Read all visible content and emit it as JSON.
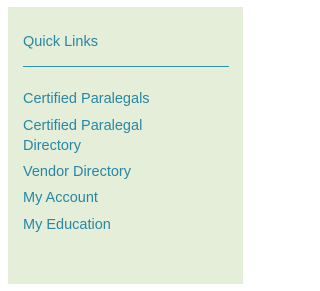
{
  "quick_links": {
    "title": "Quick Links",
    "items": [
      {
        "label": "Certified Paralegals"
      },
      {
        "label": "Certified Paralegal Directory"
      },
      {
        "label": "Vendor Directory"
      },
      {
        "label": "My Account"
      },
      {
        "label": "My Education"
      }
    ]
  },
  "colors": {
    "panel_background": "#e4eed9",
    "link_color": "#2a87a4",
    "divider_color": "#2d90ad"
  }
}
